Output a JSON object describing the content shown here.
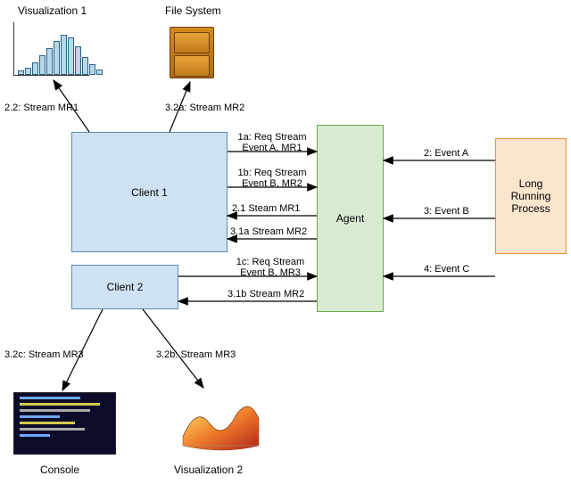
{
  "nodes": {
    "visualization1": "Visualization 1",
    "fileSystem": "File System",
    "client1": "Client 1",
    "client2": "Client 2",
    "agent": "Agent",
    "lrp": "Long\nRunning\nProcess",
    "console": "Console",
    "visualization2": "Visualization 2"
  },
  "edges": {
    "c1_vis1": "2.2: Stream MR1",
    "c1_fs": "3.2a: Stream MR2",
    "c1_agent_1a_l1": "1a: Req Stream",
    "c1_agent_1a_l2": "Event A, MR1",
    "c1_agent_1b_l1": "1b: Req Stream",
    "c1_agent_1b_l2": "Event B, MR2",
    "agent_c1_21": "2.1 Steam MR1",
    "agent_c1_31a": "3.1a Stream MR2",
    "c2_agent_1c_l1": "1c: Req Stream",
    "c2_agent_1c_l2": "Event B, MR3",
    "agent_c2_31b": "3.1b Stream MR2",
    "c2_console": "3.2c: Stream MR3",
    "c2_vis2": "3.2b: Stream MR3",
    "lrp_agent_2": "2: Event A",
    "lrp_agent_3": "3: Event B",
    "lrp_agent_4": "4: Event C"
  },
  "histogram": {
    "heights": [
      5,
      8,
      14,
      22,
      30,
      38,
      45,
      42,
      32,
      20,
      12,
      6
    ]
  }
}
